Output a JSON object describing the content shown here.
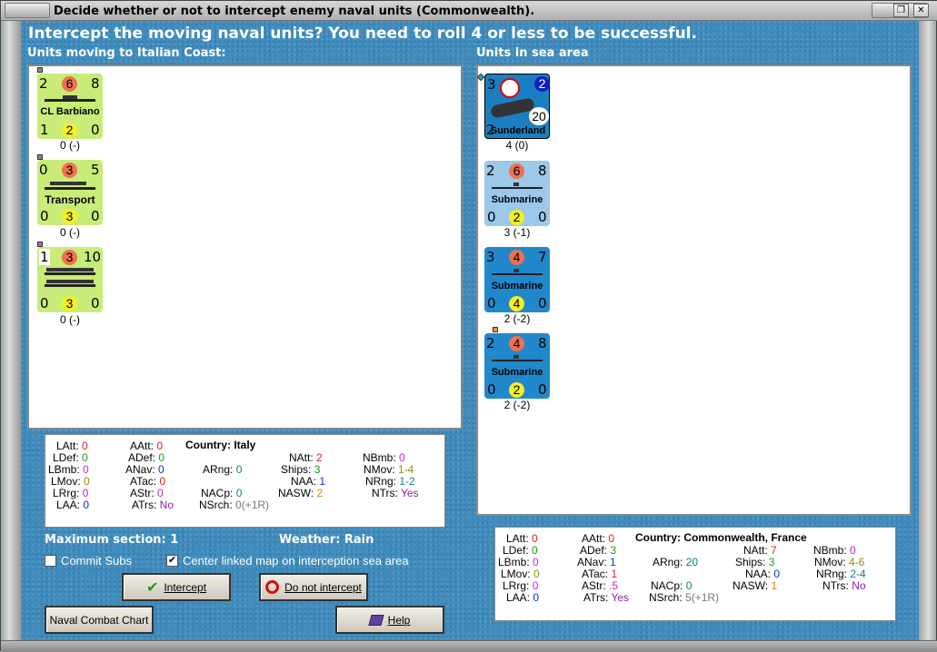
{
  "window": {
    "title": "Decide whether or not to intercept enemy naval units (Commonwealth)."
  },
  "heading": "Intercept the moving naval units?  You need to roll 4 or less to be successful.",
  "left_panel": {
    "label": "Units moving to Italian Coast:",
    "units": [
      {
        "tl": "2",
        "tc": "6",
        "tr": "8",
        "name": "CL Barbiano",
        "bl": "1",
        "bc": "2",
        "br": "0",
        "caption": "0 (-)"
      },
      {
        "tl": "0",
        "tc": "3",
        "tr": "5",
        "name": "Transport",
        "bl": "0",
        "bc": "3",
        "br": "0",
        "caption": "0 (-)"
      },
      {
        "tl": "1",
        "tc": "3",
        "tr": "10",
        "name": "",
        "bl": "0",
        "bc": "3",
        "br": "0",
        "caption": "0 (-)"
      }
    ]
  },
  "right_panel": {
    "label": "Units in sea area",
    "units": [
      {
        "tl": "3",
        "tr": "2",
        "name": "Sunderland",
        "bl": "2",
        "br": "20",
        "caption": "4 (0)"
      },
      {
        "tl": "2",
        "tc": "6",
        "tr": "8",
        "name": "Submarine",
        "bl": "0",
        "bc": "2",
        "br": "0",
        "caption": "3 (-1)"
      },
      {
        "tl": "3",
        "tc": "4",
        "tr": "7",
        "name": "Submarine",
        "bl": "0",
        "bc": "4",
        "br": "0",
        "caption": "2 (-2)"
      },
      {
        "tl": "2",
        "tc": "4",
        "tr": "8",
        "name": "Submarine",
        "bl": "0",
        "bc": "2",
        "br": "0",
        "caption": "2 (-2)"
      }
    ]
  },
  "left_stats": {
    "country": "Country: Italy",
    "LAtt": "0",
    "LDef": "0",
    "LBmb": "0",
    "LMov": "0",
    "LRrg": "0",
    "LAA": "0",
    "AAtt": "0",
    "ADef": "0",
    "ANav": "0",
    "ATac": "0",
    "AStr": "0",
    "ATrs": "No",
    "ARng": "0",
    "NACp": "0",
    "NSrch": "0(+1R)",
    "NAtt": "2",
    "Ships": "3",
    "NAA": "1",
    "NASW": "2",
    "NBmb": "0",
    "NMov": "1-4",
    "NRng": "1-2",
    "NTrs": "Yes"
  },
  "right_stats": {
    "country": "Country: Commonwealth, France",
    "LAtt": "0",
    "LDef": "0",
    "LBmb": "0",
    "LMov": "0",
    "LRrg": "0",
    "LAA": "0",
    "AAtt": "0",
    "ADef": "3",
    "ANav": "1",
    "ATac": "1",
    "AStr": ".5",
    "ATrs": "Yes",
    "ARng": "20",
    "NACp": "0",
    "NSrch": "5(+1R)",
    "NAtt": "7",
    "Ships": "3",
    "NAA": "0",
    "NASW": "1",
    "NBmb": "0",
    "NMov": "4-6",
    "NRng": "2-4",
    "NTrs": "No"
  },
  "info": {
    "max_section": "Maximum section: 1",
    "weather": "Weather:  Rain"
  },
  "checkboxes": {
    "commit_subs": "Commit Subs",
    "center_map": "Center linked map on interception sea area"
  },
  "buttons": {
    "intercept": "Intercept",
    "do_not_intercept": "Do not intercept",
    "naval_chart": "Naval Combat Chart",
    "help": "Help"
  },
  "colors": {
    "sea_bg": "#3f8dbf",
    "italy_counter": "#c8ec78",
    "cw_air_counter": "#1a7fc0",
    "cw_light_counter": "#9cc8ea",
    "cw_dark_counter": "#2288cc"
  }
}
